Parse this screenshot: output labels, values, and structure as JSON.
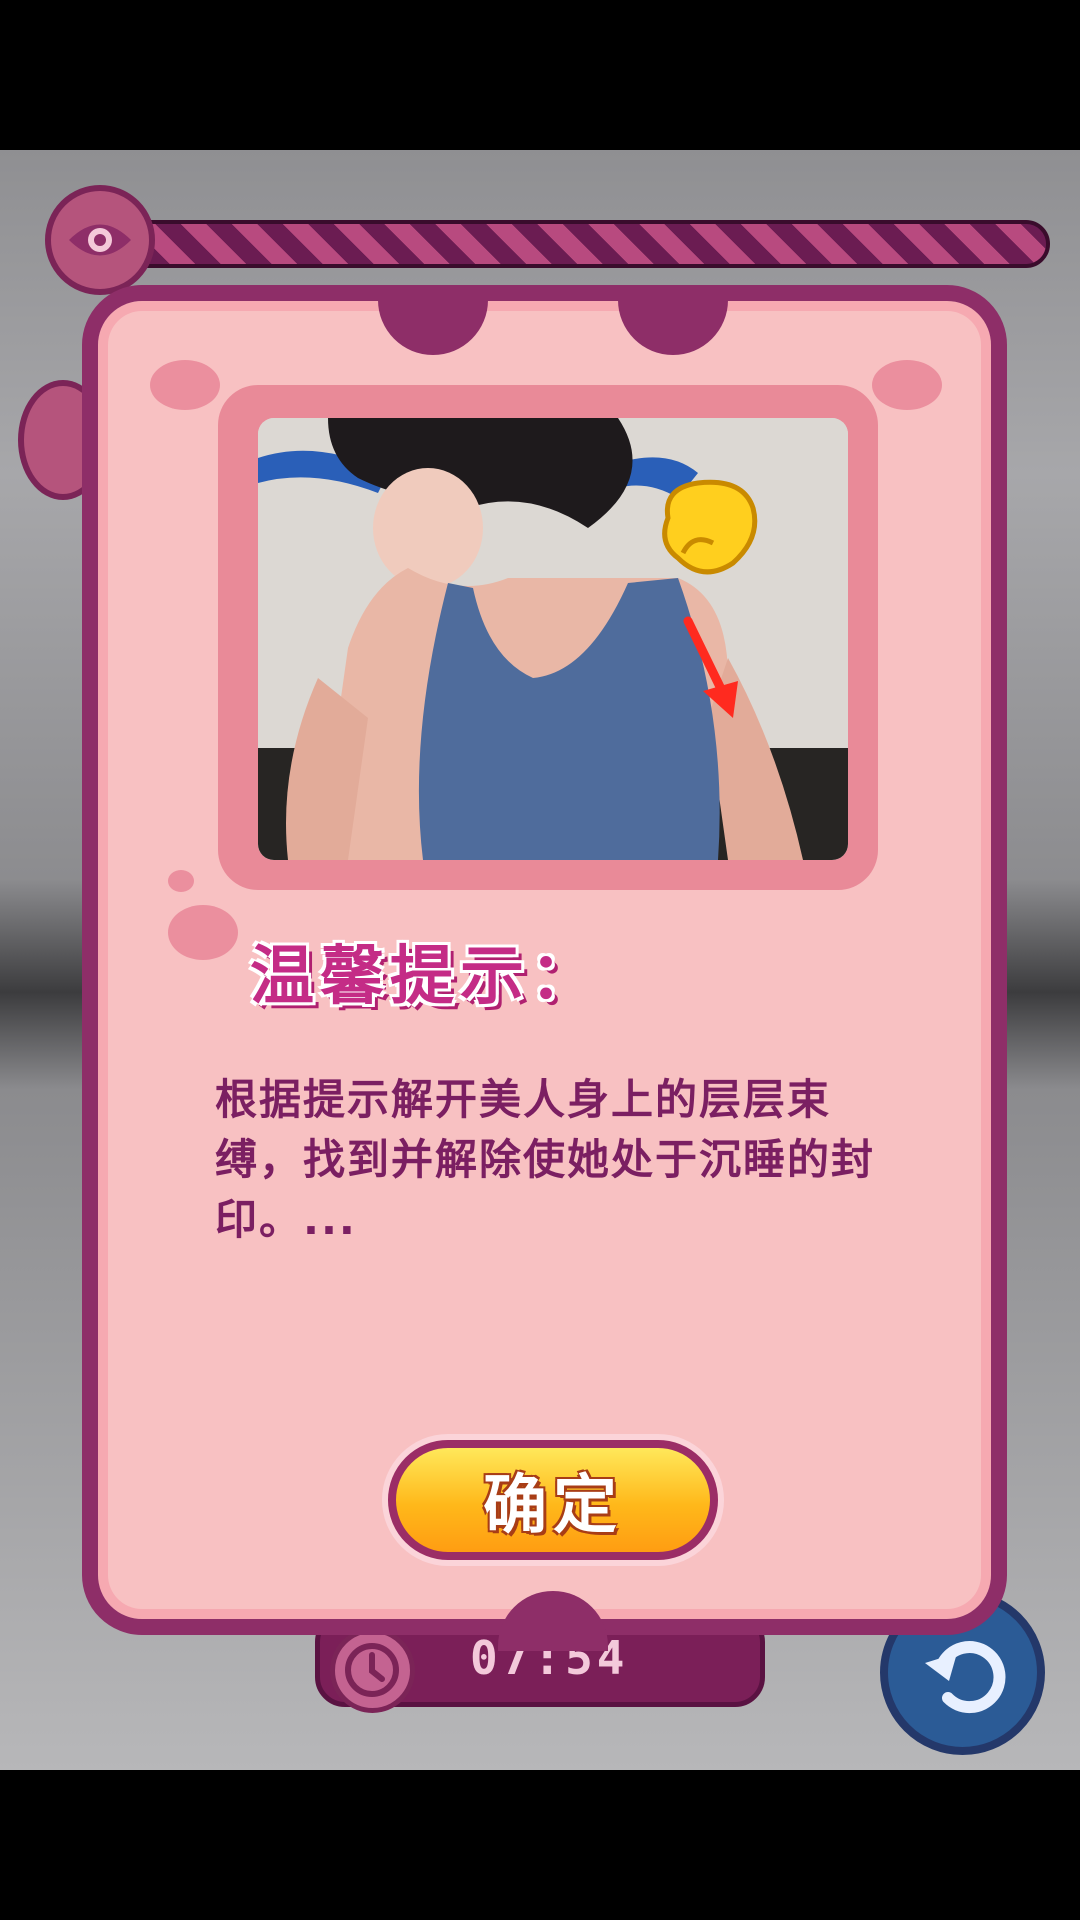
{
  "hud": {
    "progress_fraction": 1.0,
    "timer": "07:54"
  },
  "dialog": {
    "heading": "温馨提示：",
    "hint": "根据提示解开美人身上的层层束缚，找到并解除使她处于沉睡的封印。...",
    "confirm_label": "确定"
  },
  "colors": {
    "frame": "#8e2e68",
    "panel": "#f8c1c2",
    "heading": "#c42c86",
    "text": "#7b1f62",
    "button_top": "#ffe85a",
    "button_bottom": "#ff9d12"
  },
  "icons": [
    "eye-icon",
    "clock-icon",
    "undo-icon",
    "pointer-hand-icon",
    "arrow-down-icon"
  ]
}
